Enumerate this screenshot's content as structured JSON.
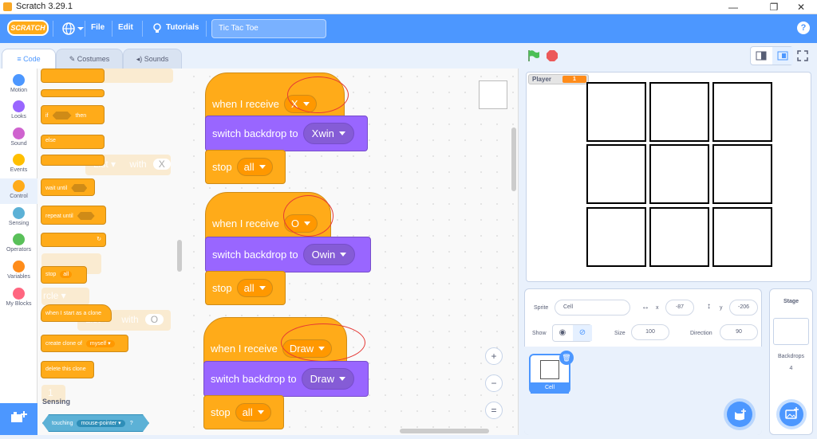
{
  "window": {
    "title": "Scratch 3.29.1",
    "minimize": "—",
    "maximize": "❐",
    "close": "✕"
  },
  "menubar": {
    "logo": "SCRATCH",
    "file": "File",
    "edit": "Edit",
    "tutorials": "Tutorials",
    "project_title": "Tic Tac Toe",
    "help": "?"
  },
  "tabs": {
    "code": "Code",
    "costumes": "Costumes",
    "sounds": "Sounds"
  },
  "categories": [
    {
      "label": "Motion",
      "color": "#4c97ff"
    },
    {
      "label": "Looks",
      "color": "#9966ff"
    },
    {
      "label": "Sound",
      "color": "#cf63cf"
    },
    {
      "label": "Events",
      "color": "#ffbf00"
    },
    {
      "label": "Control",
      "color": "#ffab19"
    },
    {
      "label": "Sensing",
      "color": "#5cb1d6"
    },
    {
      "label": "Operators",
      "color": "#59c059"
    },
    {
      "label": "Variables",
      "color": "#ff8c1a"
    },
    {
      "label": "My Blocks",
      "color": "#ff6680"
    }
  ],
  "palette": {
    "if": "if",
    "then": "then",
    "else": "else",
    "wait_until": "wait until",
    "repeat_until": "repeat until",
    "stop": "stop",
    "stop_opt": "all",
    "clone_start": "when I start as a clone",
    "create_clone": "create clone of",
    "clone_target": "myself",
    "delete_clone": "delete this clone",
    "sensing_header": "Sensing",
    "touching": "touching",
    "touching_target": "mouse-pointer",
    "q": "?",
    "ghost_list1": "List",
    "ghost_with1": "with",
    "ghost_x": "X",
    "ghost_circle": "rcle",
    "ghost_list2": "List",
    "ghost_with2": "with",
    "ghost_o": "O",
    "ghost_one": "1"
  },
  "scripts": [
    {
      "hat": "when I receive",
      "message": "X",
      "backdrop_label": "switch backdrop to",
      "backdrop": "Xwin",
      "stop": "stop",
      "stop_opt": "all"
    },
    {
      "hat": "when I receive",
      "message": "O",
      "backdrop_label": "switch backdrop to",
      "backdrop": "Owin",
      "stop": "stop",
      "stop_opt": "all"
    },
    {
      "hat": "when I receive",
      "message": "Draw",
      "backdrop_label": "switch backdrop to",
      "backdrop": "Draw",
      "stop": "stop",
      "stop_opt": "all"
    }
  ],
  "zoom": {
    "in": "+",
    "out": "−",
    "reset": "="
  },
  "stage": {
    "player_label": "Player",
    "player_value": "1"
  },
  "sprite_info": {
    "sprite_label": "Sprite",
    "sprite_name": "Cell",
    "x_label": "x",
    "x_value": "-87",
    "y_label": "y",
    "y_value": "-206",
    "show_label": "Show",
    "size_label": "Size",
    "size_value": "100",
    "direction_label": "Direction",
    "direction_value": "90"
  },
  "sprites": [
    {
      "name": "Cell"
    }
  ],
  "stage_pane": {
    "title": "Stage",
    "backdrops_label": "Backdrops",
    "backdrops_count": "4"
  }
}
